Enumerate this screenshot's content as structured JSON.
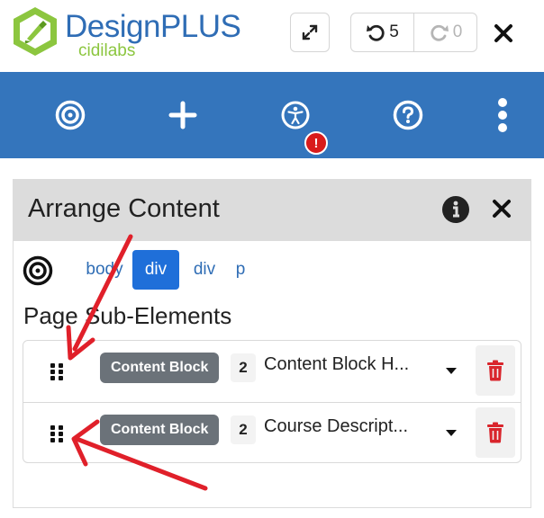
{
  "logo": {
    "title": "DesignPLUS",
    "subtitle": "cidilabs"
  },
  "history": {
    "undo_count": "5",
    "redo_count": "0"
  },
  "toolbar": {
    "items": [
      {
        "icon": "target-icon"
      },
      {
        "icon": "plus-icon"
      },
      {
        "icon": "accessibility-icon",
        "alert": "!"
      },
      {
        "icon": "help-icon"
      },
      {
        "icon": "more-vertical-icon"
      }
    ]
  },
  "panel": {
    "title": "Arrange Content",
    "breadcrumb": [
      "body",
      "div",
      "div",
      "p"
    ],
    "active_crumb": "div",
    "subheading": "Page Sub-Elements",
    "rows": [
      {
        "badge": "Content Block",
        "count": "2",
        "label": "Content Block H..."
      },
      {
        "badge": "Content Block",
        "count": "2",
        "label": "Course Descript..."
      }
    ]
  },
  "colors": {
    "brand_blue": "#3475bc",
    "brand_green": "#8cc63f",
    "active_crumb": "#1f6fd9",
    "badge_gray": "#6b7279",
    "delete_red": "#d9252c",
    "alert_red": "#d91b1b",
    "annotation_arrow": "#e0202a"
  }
}
